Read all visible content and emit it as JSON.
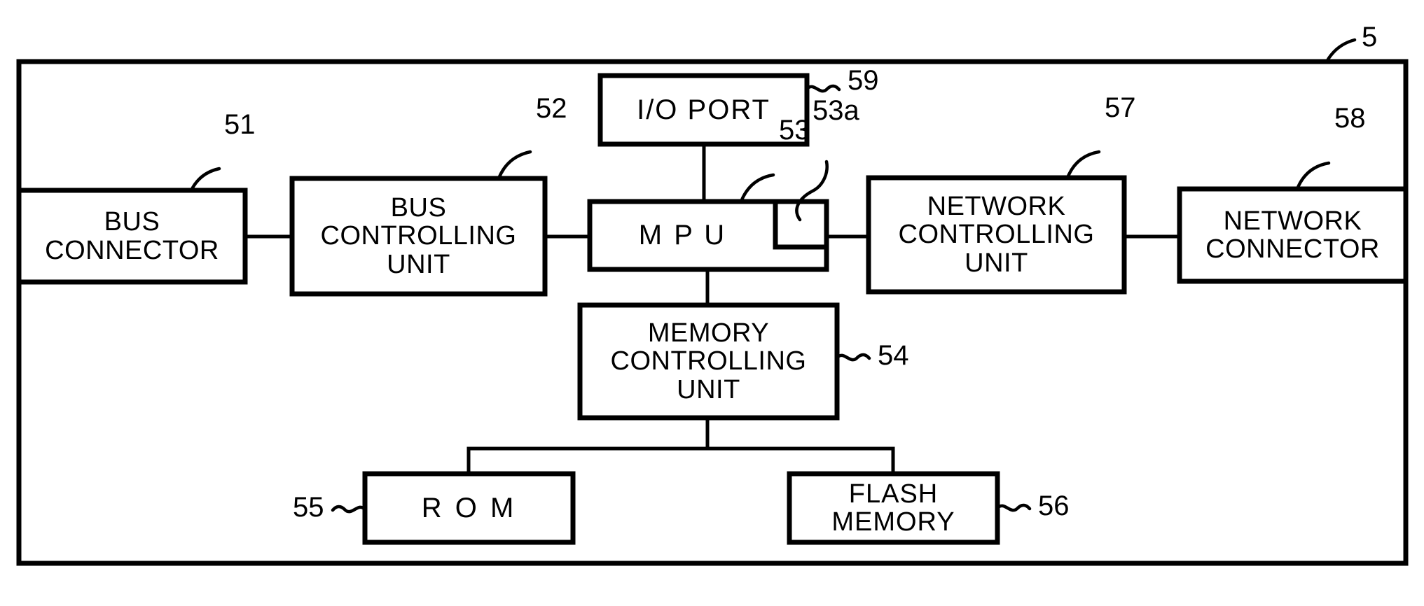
{
  "figure": {
    "type": "patent-block-diagram",
    "description": "Block diagram of a controller unit",
    "outer_frame_ref": "5"
  },
  "blocks": [
    {
      "id": "bus-connector",
      "label": "BUS\nCONNECTOR",
      "ref": "51"
    },
    {
      "id": "bus-controlling-unit",
      "label": "BUS\nCONTROLLING\nUNIT",
      "ref": "52"
    },
    {
      "id": "mpu",
      "label": "M P U",
      "ref": "53"
    },
    {
      "id": "mpu-internal",
      "label": "",
      "ref": "53a"
    },
    {
      "id": "memory-controlling-unit",
      "label": "MEMORY\nCONTROLLING\nUNIT",
      "ref": "54"
    },
    {
      "id": "rom",
      "label": "R O M",
      "ref": "55"
    },
    {
      "id": "flash-memory",
      "label": "FLASH MEMORY",
      "ref": "56"
    },
    {
      "id": "network-controlling-unit",
      "label": "NETWORK\nCONTROLLING\nUNIT",
      "ref": "57"
    },
    {
      "id": "network-connector",
      "label": "NETWORK\nCONNECTOR",
      "ref": "58"
    },
    {
      "id": "io-port",
      "label": "I/O PORT",
      "ref": "59"
    }
  ],
  "reference_numerals": {
    "outer": "5",
    "bus_connector": "51",
    "bus_controlling_unit": "52",
    "mpu": "53",
    "mpu_internal": "53a",
    "memory_controlling_unit": "54",
    "rom": "55",
    "flash_memory": "56",
    "network_controlling_unit": "57",
    "network_connector": "58",
    "io_port": "59"
  },
  "connections": [
    {
      "from": "bus-connector",
      "to": "bus-controlling-unit"
    },
    {
      "from": "bus-controlling-unit",
      "to": "mpu"
    },
    {
      "from": "io-port",
      "to": "mpu"
    },
    {
      "from": "mpu",
      "to": "network-controlling-unit"
    },
    {
      "from": "network-controlling-unit",
      "to": "network-connector"
    },
    {
      "from": "mpu",
      "to": "memory-controlling-unit"
    },
    {
      "from": "memory-controlling-unit",
      "to": "rom"
    },
    {
      "from": "memory-controlling-unit",
      "to": "flash-memory"
    }
  ],
  "colors": {
    "ink": "#000000",
    "paper": "#ffffff"
  }
}
